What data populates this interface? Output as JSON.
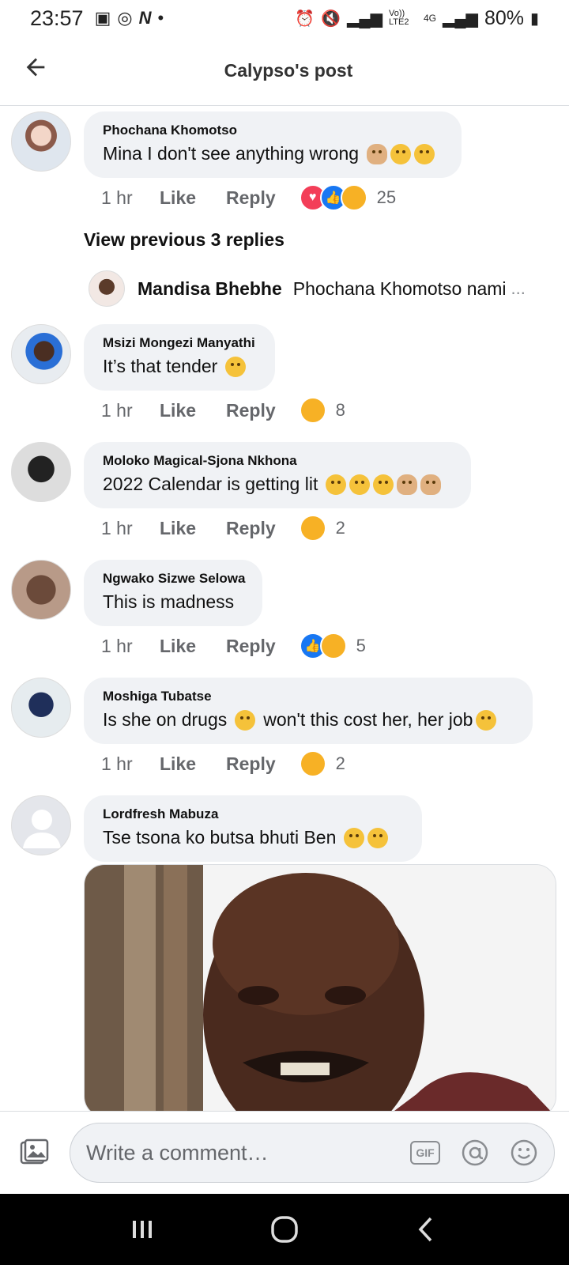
{
  "status_bar": {
    "time": "23:57",
    "battery": "80%",
    "network_1": "Vo)) LTE2",
    "network_2": "4G"
  },
  "header": {
    "title": "Calypso's post"
  },
  "comments": [
    {
      "author": "Phochana Khomotso",
      "text": "Mina I don't see anything wrong",
      "time": "1 hr",
      "like_label": "Like",
      "reply_label": "Reply",
      "reaction_count": "25"
    },
    {
      "author": "Msizi Mongezi Manyathi",
      "text": "It’s that tender",
      "time": "1 hr",
      "like_label": "Like",
      "reply_label": "Reply",
      "reaction_count": "8"
    },
    {
      "author": "Moloko Magical-Sjona Nkhona",
      "text": "2022 Calendar is getting lit",
      "time": "1 hr",
      "like_label": "Like",
      "reply_label": "Reply",
      "reaction_count": "2"
    },
    {
      "author": "Ngwako Sizwe Selowa",
      "text": "This is madness",
      "time": "1 hr",
      "like_label": "Like",
      "reply_label": "Reply",
      "reaction_count": "5"
    },
    {
      "author": "Moshiga Tubatse",
      "text_part1": "Is she on drugs",
      "text_part2": "won't this cost her, her job",
      "time": "1 hr",
      "like_label": "Like",
      "reply_label": "Reply",
      "reaction_count": "2"
    },
    {
      "author": "Lordfresh Mabuza",
      "text": "Tse tsona ko butsa bhuti Ben"
    }
  ],
  "replies": {
    "view_previous": "View previous 3 replies",
    "latest_author": "Mandisa Bhebhe",
    "latest_text": "Phochana Khomotso nami",
    "ellipsis": "..."
  },
  "composer": {
    "placeholder": "Write a comment…",
    "gif_label": "GIF"
  },
  "colors": {
    "bubble_bg": "#f0f2f5",
    "love": "#f33e58",
    "like": "#1877f2",
    "haha": "#f7b125"
  },
  "icons": {
    "back": "left-arrow",
    "photo": "photo-icon",
    "mention": "at-icon",
    "emoji": "smiley-icon"
  }
}
